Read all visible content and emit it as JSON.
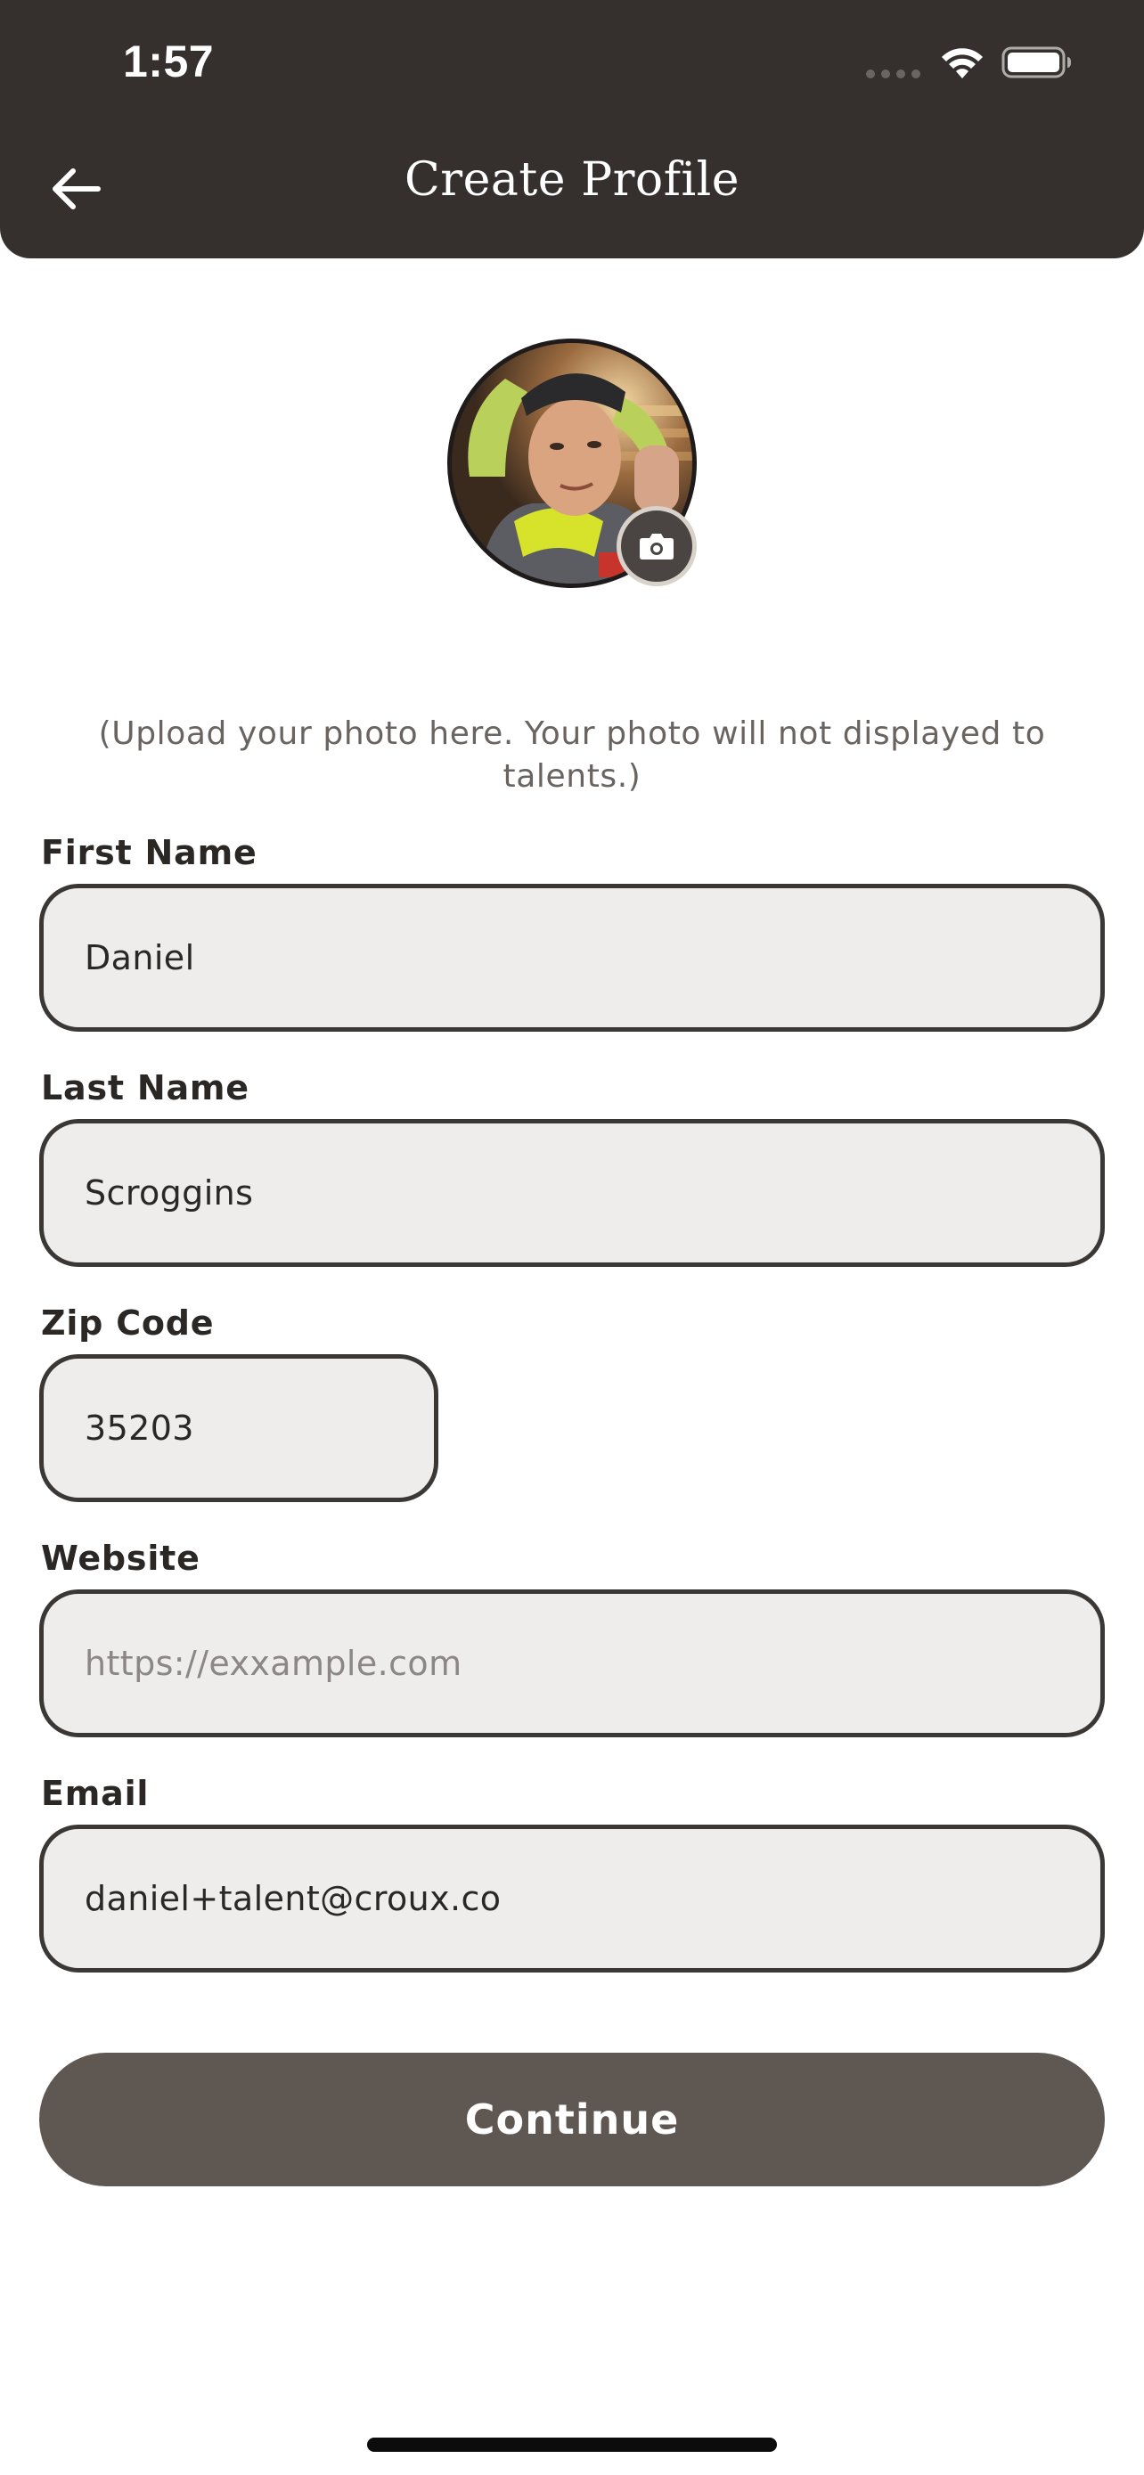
{
  "status_bar": {
    "time": "1:57"
  },
  "header": {
    "title": "Create Profile"
  },
  "avatar": {
    "icon": "camera-icon"
  },
  "upload_hint": "(Upload your photo here. Your photo will not displayed to talents.)",
  "form": {
    "first_name": {
      "label": "First Name",
      "value": "Daniel",
      "placeholder": ""
    },
    "last_name": {
      "label": "Last Name",
      "value": "Scroggins",
      "placeholder": ""
    },
    "zip_code": {
      "label": "Zip Code",
      "value": "35203",
      "placeholder": ""
    },
    "website": {
      "label": "Website",
      "value": "",
      "placeholder": "https://exxample.com"
    },
    "email": {
      "label": "Email",
      "value": "daniel+talent@croux.co",
      "placeholder": ""
    }
  },
  "continue_label": "Continue",
  "colors": {
    "header_bg": "#35302e",
    "input_bg": "#eeedeb",
    "button_bg": "#5f5752"
  }
}
